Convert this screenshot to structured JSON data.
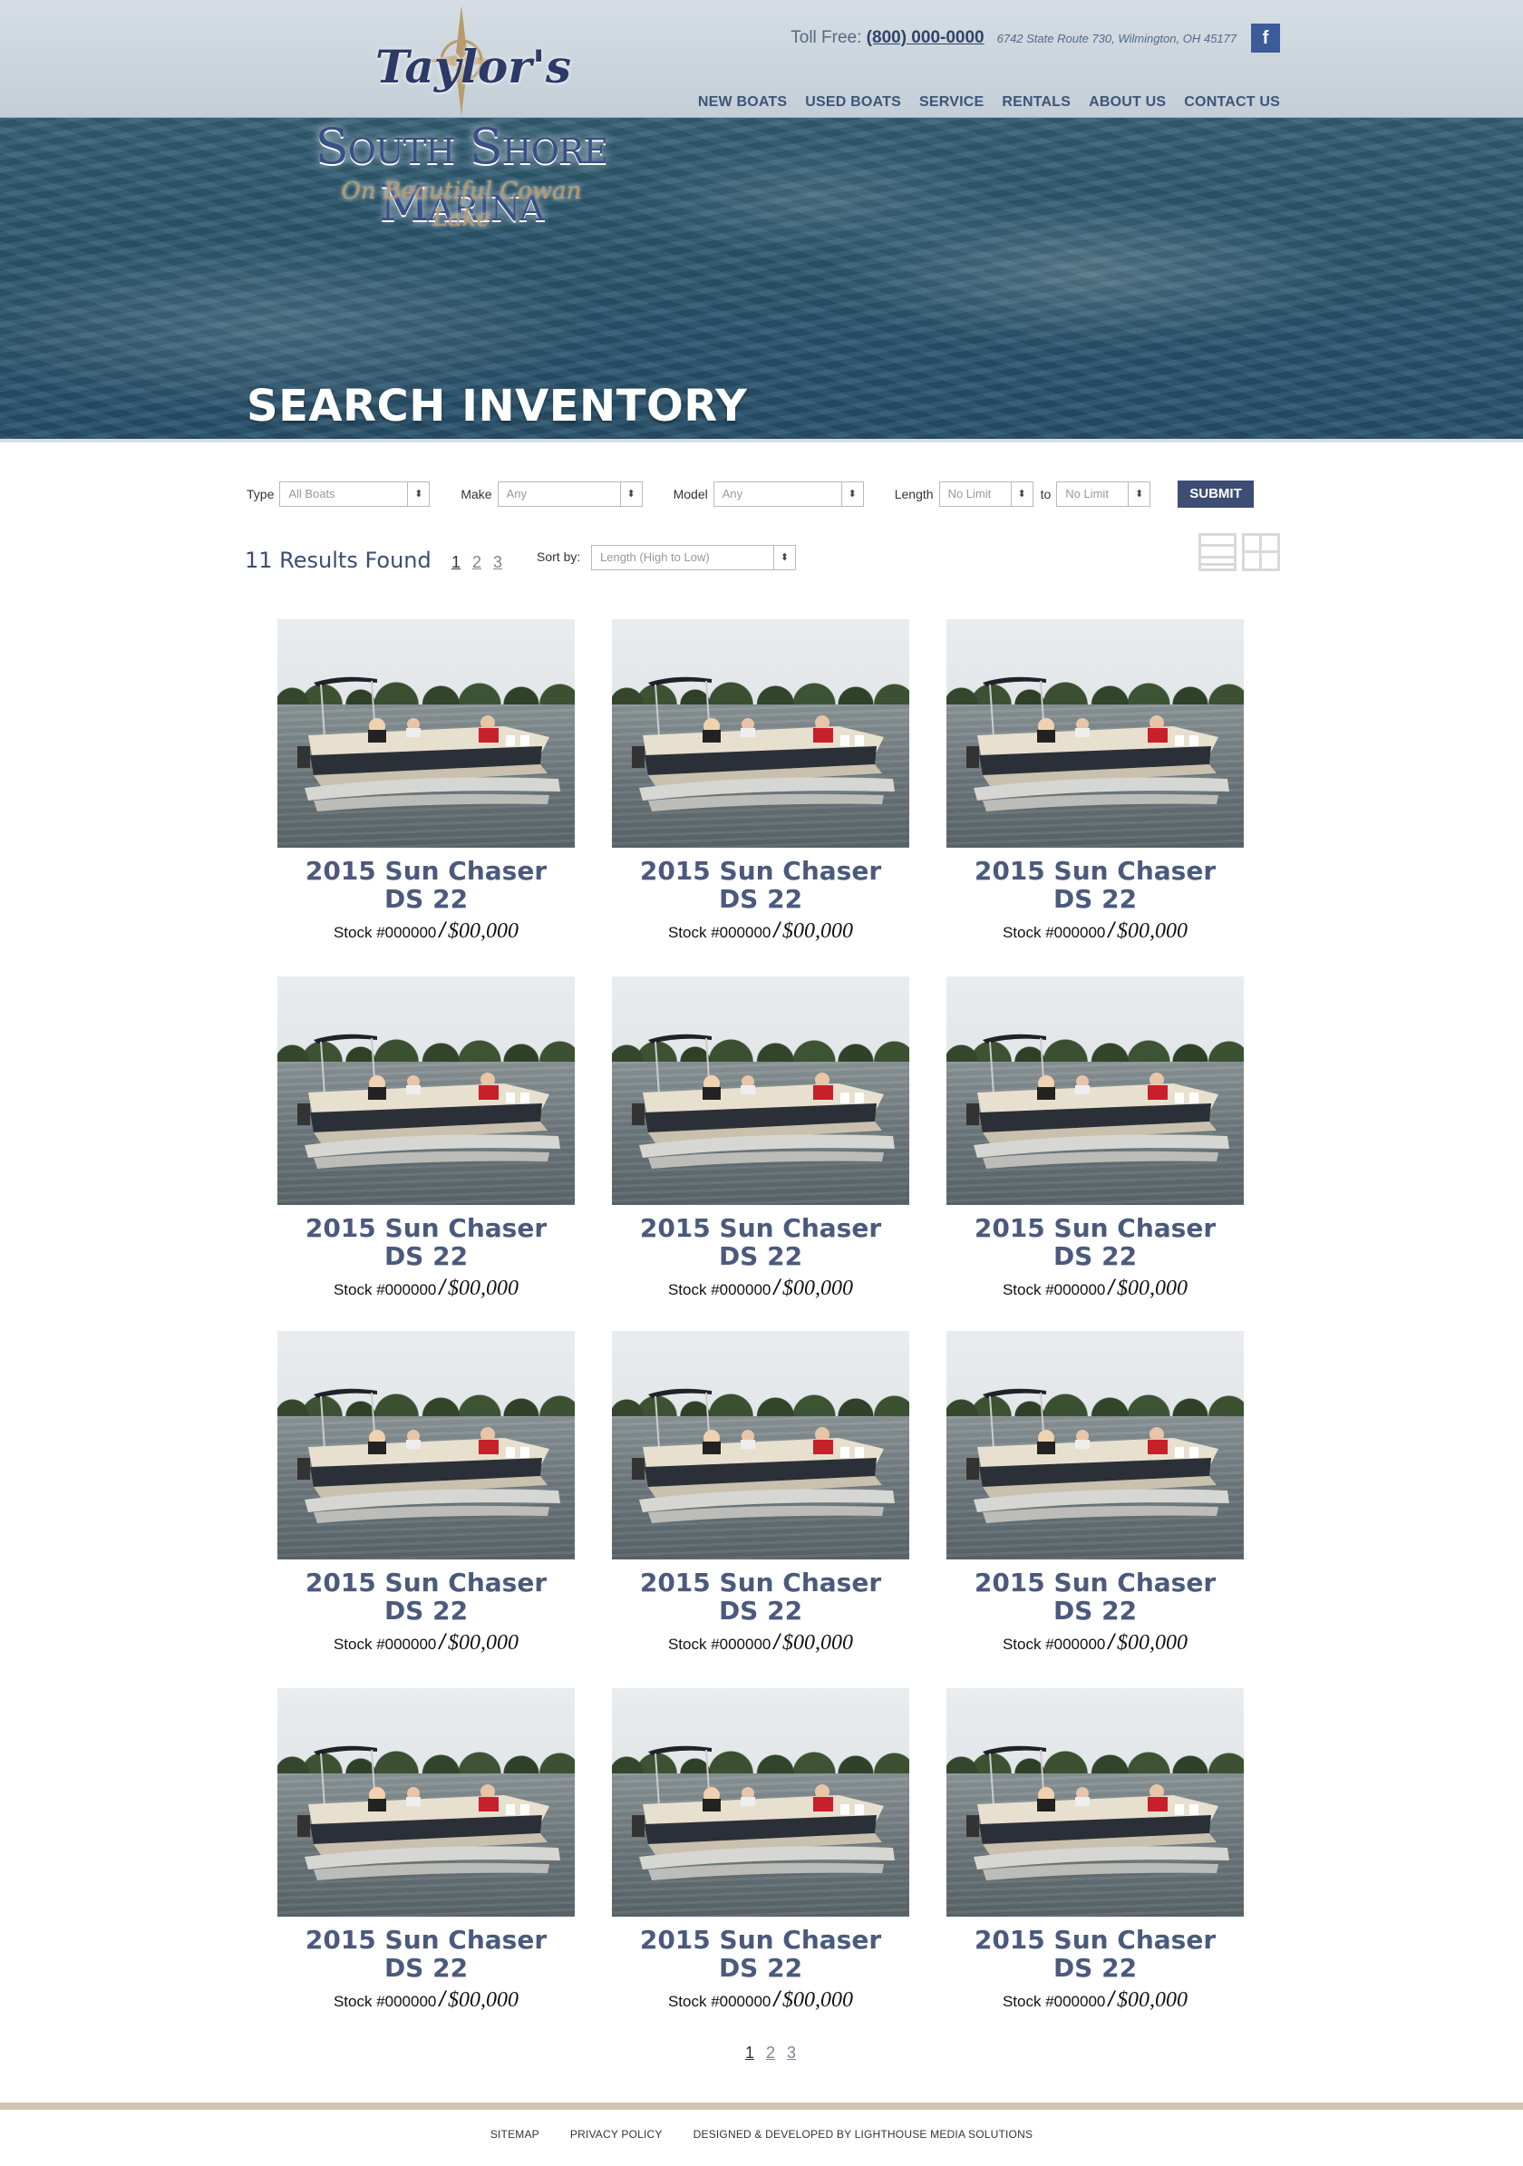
{
  "brand": {
    "logo_line1": "Taylor's",
    "logo_line2": "South Shore Marina",
    "logo_tagline": "On Beautiful Cowan Lake"
  },
  "header": {
    "toll_free_label": "Toll Free:",
    "phone": "(800) 000-0000",
    "address": "6742 State Route 730,  Wilmington, OH 45177",
    "facebook_icon": "f",
    "nav": [
      {
        "label": "NEW BOATS"
      },
      {
        "label": "USED BOATS"
      },
      {
        "label": "SERVICE"
      },
      {
        "label": "RENTALS"
      },
      {
        "label": "ABOUT US"
      },
      {
        "label": "CONTACT US"
      }
    ]
  },
  "page_title": "SEARCH INVENTORY",
  "filters": {
    "type_label": "Type",
    "type_value": "All Boats",
    "make_label": "Make",
    "make_value": "Any",
    "model_label": "Model",
    "model_value": "Any",
    "length_label": "Length",
    "length_from": "No Limit",
    "to_label": "to",
    "length_to": "No Limit",
    "submit_label": "SUBMIT"
  },
  "results": {
    "count_text": "11 Results Found",
    "pages": [
      "1",
      "2",
      "3"
    ],
    "current_page": "1",
    "sort_label": "Sort by:",
    "sort_value": "Length (High to Low)"
  },
  "listings": [
    {
      "title_line1": "2015 Sun Chaser",
      "title_line2": "DS 22",
      "stock": "Stock #000000",
      "price": "$00,000"
    },
    {
      "title_line1": "2015 Sun Chaser",
      "title_line2": "DS 22",
      "stock": "Stock #000000",
      "price": "$00,000"
    },
    {
      "title_line1": "2015 Sun Chaser",
      "title_line2": "DS 22",
      "stock": "Stock #000000",
      "price": "$00,000"
    },
    {
      "title_line1": "2015 Sun Chaser",
      "title_line2": "DS 22",
      "stock": "Stock #000000",
      "price": "$00,000"
    },
    {
      "title_line1": "2015 Sun Chaser",
      "title_line2": "DS 22",
      "stock": "Stock #000000",
      "price": "$00,000"
    },
    {
      "title_line1": "2015 Sun Chaser",
      "title_line2": "DS 22",
      "stock": "Stock #000000",
      "price": "$00,000"
    },
    {
      "title_line1": "2015 Sun Chaser",
      "title_line2": "DS 22",
      "stock": "Stock #000000",
      "price": "$00,000"
    },
    {
      "title_line1": "2015 Sun Chaser",
      "title_line2": "DS 22",
      "stock": "Stock #000000",
      "price": "$00,000"
    },
    {
      "title_line1": "2015 Sun Chaser",
      "title_line2": "DS 22",
      "stock": "Stock #000000",
      "price": "$00,000"
    },
    {
      "title_line1": "2015 Sun Chaser",
      "title_line2": "DS 22",
      "stock": "Stock #000000",
      "price": "$00,000"
    },
    {
      "title_line1": "2015 Sun Chaser",
      "title_line2": "DS 22",
      "stock": "Stock #000000",
      "price": "$00,000"
    },
    {
      "title_line1": "2015 Sun Chaser",
      "title_line2": "DS 22",
      "stock": "Stock #000000",
      "price": "$00,000"
    }
  ],
  "footer": {
    "links": [
      {
        "label": "SITEMAP"
      },
      {
        "label": "PRIVACY POLICY"
      },
      {
        "label": "DESIGNED & DEVELOPED BY LIGHTHOUSE MEDIA SOLUTIONS"
      }
    ]
  },
  "colors": {
    "brand_navy": "#3d4d73",
    "heading_blue": "#4b5a7c",
    "nav_blue": "#3d5576",
    "facebook_blue": "#3b5b99",
    "footer_bar": "#cfc5b2"
  },
  "icons": {
    "compass": "compass-rose-icon",
    "facebook": "facebook-icon",
    "list_view": "list-view-icon",
    "grid_view": "grid-view-icon",
    "select_arrow": "select-arrow-icon"
  }
}
